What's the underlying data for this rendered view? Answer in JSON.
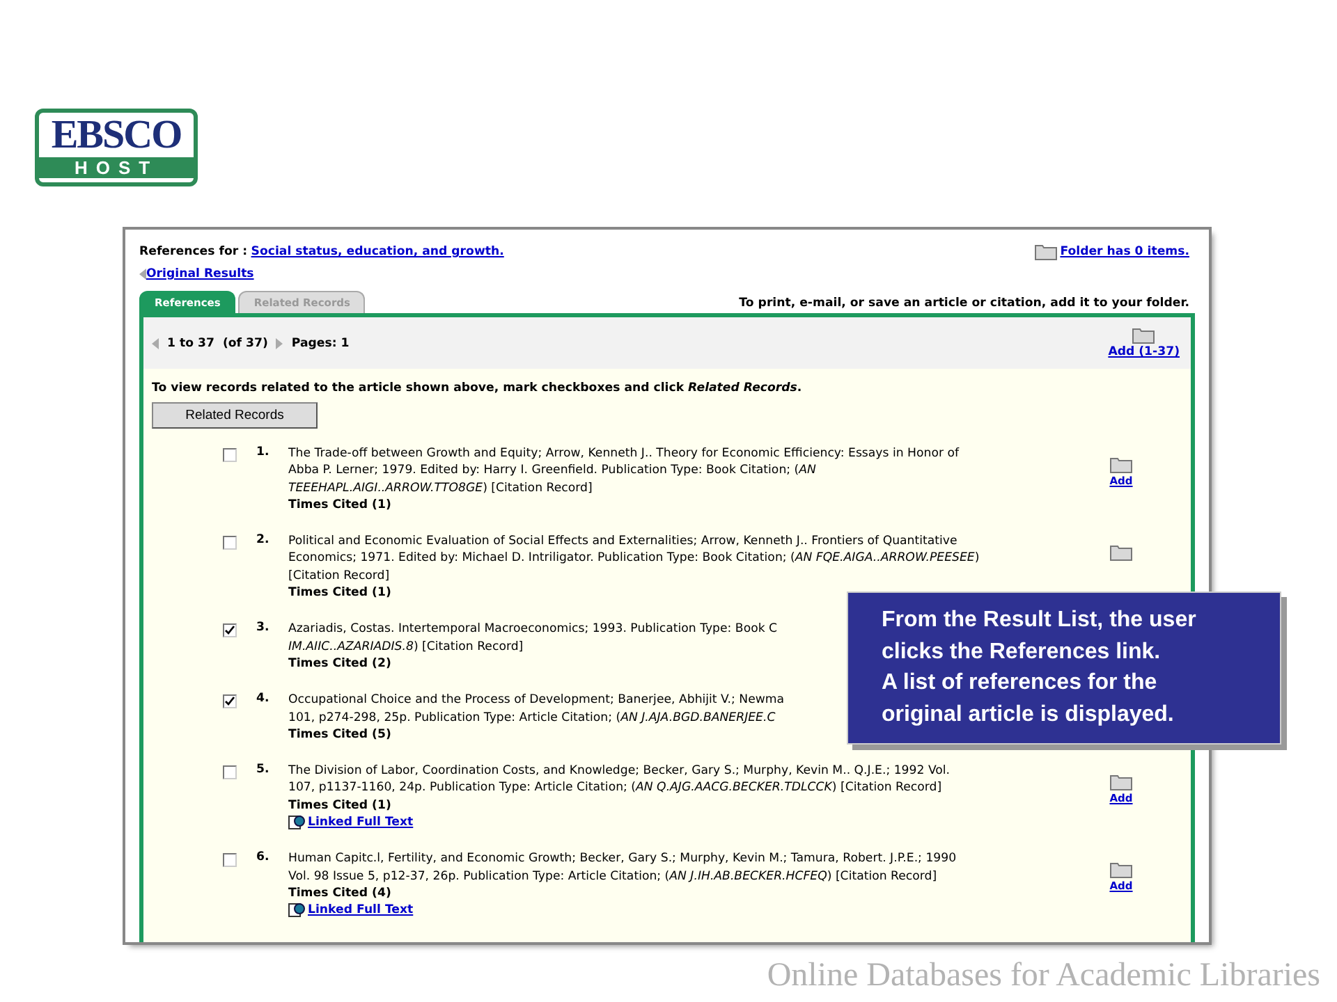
{
  "logo": {
    "word": "EBSCO",
    "band": "HOST"
  },
  "header": {
    "label": "References for :",
    "title_link": "Social status, education, and growth.",
    "folder_link": "Folder has 0 items.",
    "back_link": "Original Results"
  },
  "tabs": [
    {
      "label": "References",
      "selected": true
    },
    {
      "label": "Related Records",
      "selected": false
    }
  ],
  "folder_hint": "To print, e-mail, or save an article or citation, add it to your folder.",
  "pager": {
    "range": "1 to 37",
    "total": "(of 37)",
    "pages_label": "Pages: 1",
    "add_link": "Add (1-37)"
  },
  "instruction": "To view records related to the article shown above, mark checkboxes and click *Related Records*.",
  "related_button": "Related Records",
  "results": [
    {
      "number": "1.",
      "checked": false,
      "lines": [
        "The Trade-off between Growth and Equity; Arrow, Kenneth J.. Theory for Economic Efficiency: Essays in Honor of",
        "Abba P. Lerner; 1979. Edited by: Harry I. Greenfield. Publication Type: Book Citation; (*AN*",
        "*TEEEHAPL.AIGI..ARROW.TTO8GE*) [Citation Record]"
      ],
      "times_cited": "Times Cited (1)",
      "folder": true,
      "add": "Add"
    },
    {
      "number": "2.",
      "checked": false,
      "lines": [
        "Political and Economic Evaluation of Social Effects and Externalities; Arrow, Kenneth J.. Frontiers of Quantitative",
        "Economics; 1971. Edited by: Michael D. Intriligator. Publication Type: Book Citation; (*AN FQE.AIGA..ARROW.PEESEE*)",
        "[Citation Record]"
      ],
      "times_cited": "Times Cited (1)",
      "folder": true
    },
    {
      "number": "3.",
      "checked": true,
      "lines": [
        "Azariadis, Costas. Intertemporal Macroeconomics; 1993. Publication Type: Book C",
        "*IM.AIIC..AZARIADIS.8*) [Citation Record]"
      ],
      "times_cited": "Times Cited (2)",
      "folder": false
    },
    {
      "number": "4.",
      "checked": true,
      "lines": [
        "Occupational Choice and the Process of Development; Banerjee, Abhijit V.; Newma",
        "101, p274-298, 25p. Publication Type: Article Citation; (*AN J.AJA.BGD.BANERJEE.C*"
      ],
      "times_cited": "Times Cited (5)",
      "folder": false
    },
    {
      "number": "5.",
      "checked": false,
      "lines": [
        "The Division of Labor, Coordination Costs, and Knowledge; Becker, Gary S.; Murphy, Kevin M.. Q.J.E.; 1992 Vol.",
        "107, p1137-1160, 24p. Publication Type: Article Citation; (*AN Q.AJG.AACG.BECKER.TDLCCK*) [Citation Record]"
      ],
      "times_cited": "Times Cited (1)",
      "full_text": "Linked Full Text",
      "folder": true,
      "add": "Add"
    },
    {
      "number": "6.",
      "checked": false,
      "lines": [
        "Human Capitc.l, Fertility, and Economic Growth; Becker, Gary S.; Murphy, Kevin M.; Tamura, Robert. J.P.E.; 1990",
        "Vol. 98 Issue 5, p12-37, 26p. Publication Type: Article Citation; (*AN J.IH.AB.BECKER.HCFEQ*) [Citation Record]"
      ],
      "times_cited": "Times Cited (4)",
      "full_text": "Linked Full Text",
      "folder": true,
      "add": "Add"
    }
  ],
  "callout": {
    "lines": [
      "From the Result List, the user",
      "clicks the References link.",
      "A list of references for the",
      "original article is displayed."
    ]
  },
  "footer": "Online Databases for Academic Libraries"
}
